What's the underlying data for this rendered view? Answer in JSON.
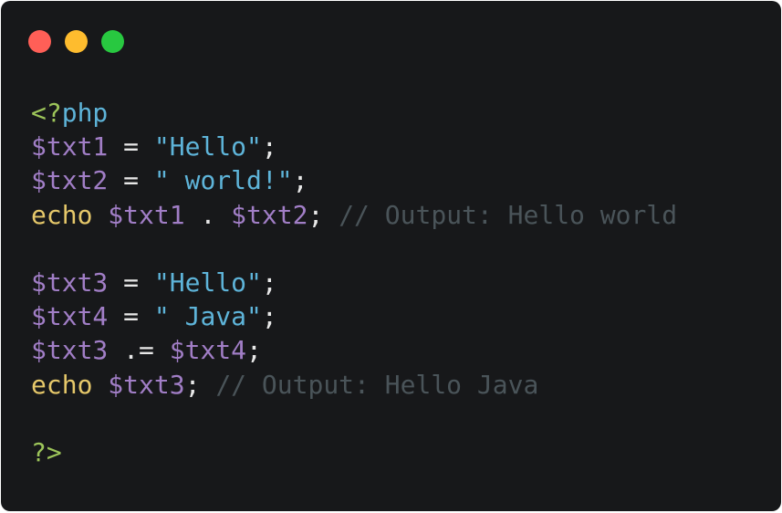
{
  "window": {
    "controls": [
      {
        "name": "close",
        "color": "#ff5f57"
      },
      {
        "name": "minimize",
        "color": "#febc2e"
      },
      {
        "name": "maximize",
        "color": "#28c840"
      }
    ]
  },
  "code": {
    "language": "php",
    "lines": [
      [
        {
          "t": "tag",
          "v": "<?"
        },
        {
          "t": "kw-php",
          "v": "php"
        }
      ],
      [
        {
          "t": "var",
          "v": "$txt1"
        },
        {
          "t": "op",
          "v": " = "
        },
        {
          "t": "str",
          "v": "\"Hello\""
        },
        {
          "t": "punc",
          "v": ";"
        }
      ],
      [
        {
          "t": "var",
          "v": "$txt2"
        },
        {
          "t": "op",
          "v": " = "
        },
        {
          "t": "str",
          "v": "\" world!\""
        },
        {
          "t": "punc",
          "v": ";"
        }
      ],
      [
        {
          "t": "fn",
          "v": "echo"
        },
        {
          "t": "op",
          "v": " "
        },
        {
          "t": "var",
          "v": "$txt1"
        },
        {
          "t": "op",
          "v": " . "
        },
        {
          "t": "var",
          "v": "$txt2"
        },
        {
          "t": "punc",
          "v": ";"
        },
        {
          "t": "op",
          "v": " "
        },
        {
          "t": "comment",
          "v": "// Output: Hello world"
        }
      ],
      [],
      [
        {
          "t": "var",
          "v": "$txt3"
        },
        {
          "t": "op",
          "v": " = "
        },
        {
          "t": "str",
          "v": "\"Hello\""
        },
        {
          "t": "punc",
          "v": ";"
        }
      ],
      [
        {
          "t": "var",
          "v": "$txt4"
        },
        {
          "t": "op",
          "v": " = "
        },
        {
          "t": "str",
          "v": "\" Java\""
        },
        {
          "t": "punc",
          "v": ";"
        }
      ],
      [
        {
          "t": "var",
          "v": "$txt3"
        },
        {
          "t": "op",
          "v": " .= "
        },
        {
          "t": "var",
          "v": "$txt4"
        },
        {
          "t": "punc",
          "v": ";"
        }
      ],
      [
        {
          "t": "fn",
          "v": "echo"
        },
        {
          "t": "op",
          "v": " "
        },
        {
          "t": "var",
          "v": "$txt3"
        },
        {
          "t": "punc",
          "v": ";"
        },
        {
          "t": "op",
          "v": " "
        },
        {
          "t": "comment",
          "v": "// Output: Hello Java"
        }
      ],
      [],
      [
        {
          "t": "tag",
          "v": "?>"
        }
      ]
    ]
  }
}
